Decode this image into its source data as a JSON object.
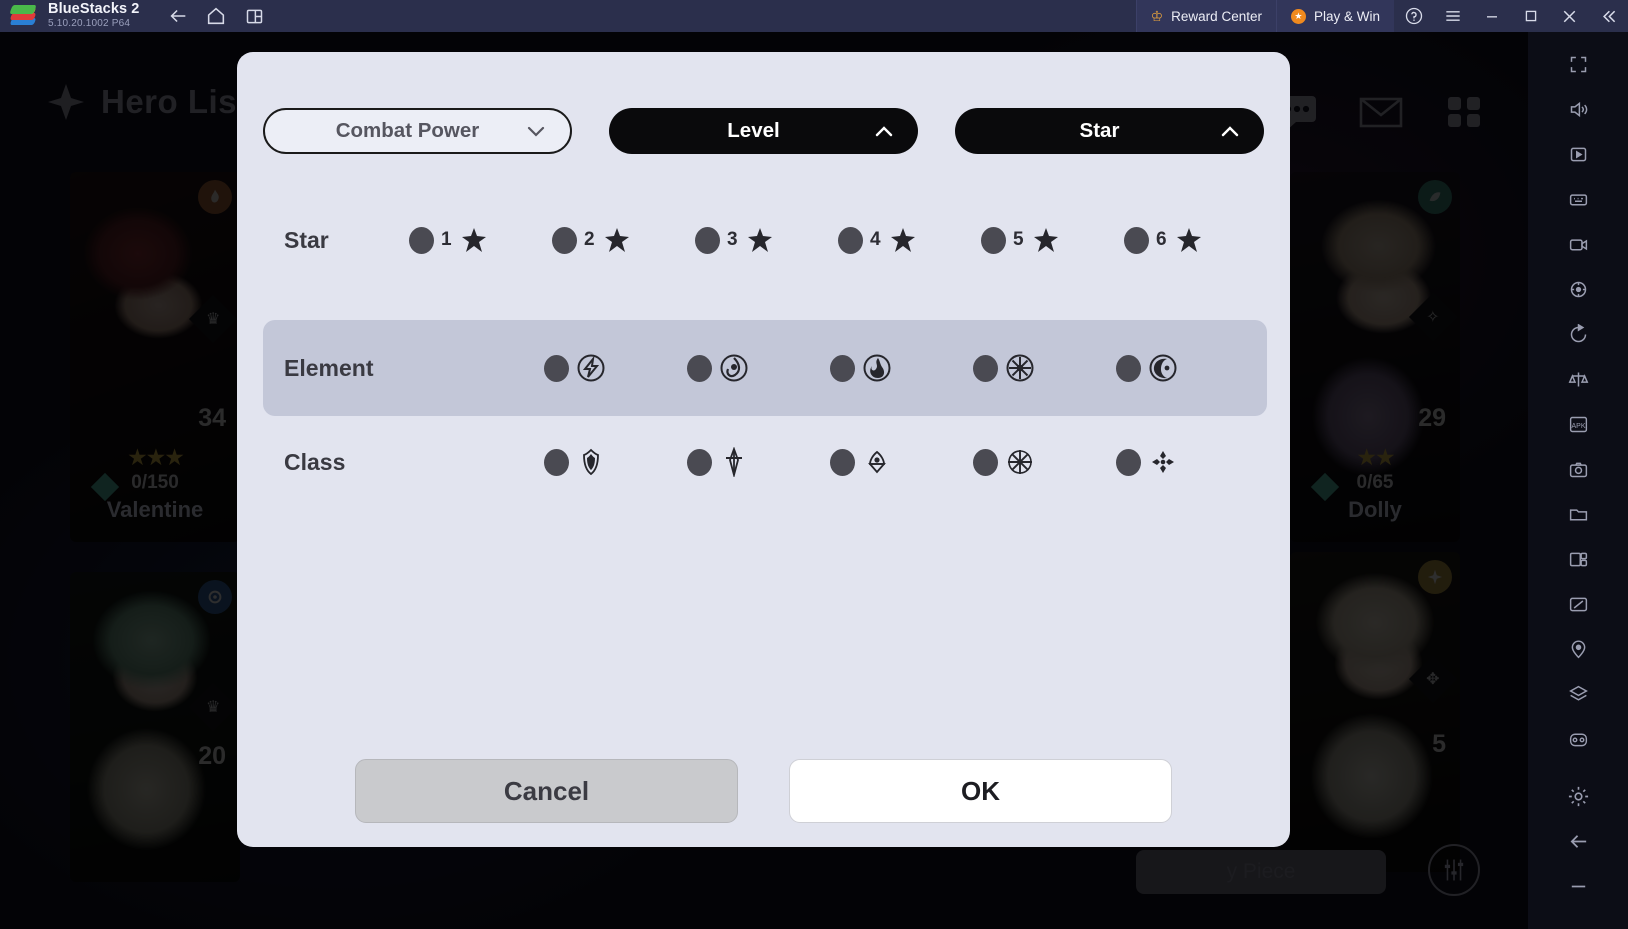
{
  "titlebar": {
    "app_name": "BlueStacks 2",
    "version": "5.10.20.1002  P64",
    "logo_icon": "bluestacks-logo",
    "nav": [
      {
        "name": "back-button",
        "icon": "arrow-left-icon"
      },
      {
        "name": "home-button",
        "icon": "home-icon"
      },
      {
        "name": "multi-instance-button",
        "icon": "window-layout-icon"
      }
    ],
    "reward_center": {
      "label": "Reward Center",
      "icon": "crown-icon"
    },
    "play_and_win": {
      "label": "Play & Win",
      "icon": "orange-badge-icon"
    },
    "help_icon": "question-circle-icon",
    "menu_icon": "hamburger-menu-icon",
    "minimize_icon": "minimize-icon",
    "maximize_icon": "maximize-icon",
    "close_icon": "close-icon",
    "collapse_icon": "double-chevron-left-icon",
    "accent_blue": "#2b2f4c",
    "accent_orange": "#f08a1e",
    "accent_gold": "#e8a33d"
  },
  "game": {
    "page_title": "Hero List",
    "page_title_icon": "four-point-star-icon",
    "help_badge": "?",
    "header_icons": [
      {
        "name": "event-flower-icon",
        "icon": "flower-icon"
      },
      {
        "name": "gem-counter-icon",
        "icon": "gem-icon"
      },
      {
        "name": "chat-icon",
        "icon": "speech-bubble-icon"
      },
      {
        "name": "mail-icon",
        "icon": "envelope-icon"
      },
      {
        "name": "menu-grid-icon",
        "icon": "grid-icon"
      }
    ],
    "heroes": [
      {
        "name": "Valentine",
        "level": "34",
        "count": "0/150",
        "stars": 3,
        "element_icon": "flame-element-icon",
        "element_color": "#c4682e",
        "class_icon": "crown-class-icon"
      },
      {
        "name": "Dolly",
        "level": "29",
        "count": "0/65",
        "stars": 2,
        "element_icon": "nature-element-icon",
        "element_color": "#2e9c8c",
        "class_icon": "wheel-class-icon"
      },
      {
        "name": "",
        "level": "20",
        "count": "",
        "stars": 0,
        "element_icon": "water-element-icon",
        "element_color": "#2a6ec4",
        "class_icon": "crown-class-icon"
      },
      {
        "name": "",
        "level": "5",
        "count": "",
        "stars": 0,
        "element_icon": "light-element-icon",
        "element_color": "#c8a02e",
        "class_icon": "cross-class-icon"
      }
    ],
    "piece_button": "y Piece",
    "equalizer_icon": "equalizer-icon"
  },
  "modal": {
    "tabs": [
      {
        "label": "Combat Power",
        "state": "inactive",
        "chevron": "chevron-down-icon"
      },
      {
        "label": "Level",
        "state": "active",
        "chevron": "chevron-up-icon"
      },
      {
        "label": "Star",
        "state": "active",
        "chevron": "chevron-up-icon"
      }
    ],
    "filters": [
      {
        "label": "Star",
        "highlighted": false,
        "options": [
          {
            "num": "1",
            "icon": "star-icon",
            "selected": false
          },
          {
            "num": "2",
            "icon": "star-icon",
            "selected": false
          },
          {
            "num": "3",
            "icon": "star-icon",
            "selected": false
          },
          {
            "num": "4",
            "icon": "star-icon",
            "selected": false
          },
          {
            "num": "5",
            "icon": "star-icon",
            "selected": false
          },
          {
            "num": "6",
            "icon": "star-icon",
            "selected": false
          }
        ]
      },
      {
        "label": "Element",
        "highlighted": true,
        "options": [
          {
            "num": "",
            "icon": "lightning-element-icon",
            "selected": false
          },
          {
            "num": "",
            "icon": "water-element-icon",
            "selected": false
          },
          {
            "num": "",
            "icon": "fire-element-icon",
            "selected": false
          },
          {
            "num": "",
            "icon": "snowflake-element-icon",
            "selected": false
          },
          {
            "num": "",
            "icon": "moon-element-icon",
            "selected": false
          }
        ]
      },
      {
        "label": "Class",
        "highlighted": false,
        "options": [
          {
            "num": "",
            "icon": "shield-class-icon",
            "selected": false
          },
          {
            "num": "",
            "icon": "sword-class-icon",
            "selected": false
          },
          {
            "num": "",
            "icon": "bow-class-icon",
            "selected": false
          },
          {
            "num": "",
            "icon": "compass-star-class-icon",
            "selected": false
          },
          {
            "num": "",
            "icon": "four-dots-class-icon",
            "selected": false
          }
        ]
      }
    ],
    "cancel_label": "Cancel",
    "ok_label": "OK",
    "bg_color": "#e2e4ef",
    "highlight_row_color": "#c3c7d8"
  },
  "sidebar": {
    "items": [
      {
        "name": "fullscreen-icon"
      },
      {
        "name": "volume-icon"
      },
      {
        "name": "screenshot-icon"
      },
      {
        "name": "keymap-icon"
      },
      {
        "name": "video-record-icon"
      },
      {
        "name": "location-icon"
      },
      {
        "name": "rotate-icon"
      },
      {
        "name": "scales-icon"
      },
      {
        "name": "apk-install-icon"
      },
      {
        "name": "camera-icon"
      },
      {
        "name": "folder-icon"
      },
      {
        "name": "multi-window-icon"
      },
      {
        "name": "macro-icon"
      },
      {
        "name": "pin-icon"
      },
      {
        "name": "layers-icon"
      },
      {
        "name": "gamepad-icon"
      }
    ],
    "bottom_items": [
      {
        "name": "settings-gear-icon"
      },
      {
        "name": "back-arrow-icon"
      },
      {
        "name": "minimize-dash-icon"
      }
    ]
  }
}
